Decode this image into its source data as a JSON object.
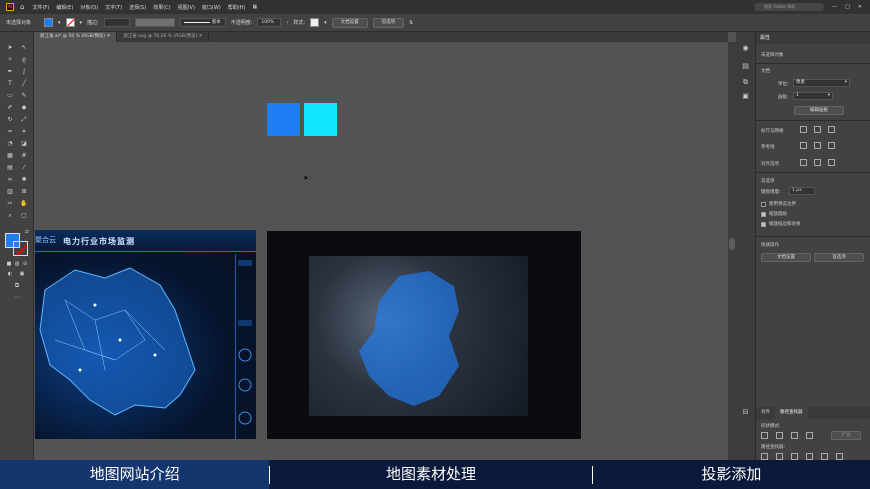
{
  "app": {
    "logo": "Ai",
    "menu": [
      "文件(F)",
      "编辑(E)",
      "对象(O)",
      "文字(T)",
      "选择(S)",
      "效果(C)",
      "视图(V)",
      "窗口(W)",
      "帮助(H)"
    ],
    "search_placeholder": "搜索 Adobe 帮助",
    "window_controls": [
      "—",
      "□",
      "✕"
    ]
  },
  "control_bar": {
    "selection_label": "未选择对象",
    "stroke_label": "描边:",
    "stroke_style": "基本",
    "opacity_label": "不透明度:",
    "opacity_value": "100%",
    "style_label": "样式:",
    "doc_setup_button": "文档设置",
    "prefs_button": "首选项"
  },
  "tabs": [
    {
      "label": "浙江省.ai* @ 50 % (RGB/预览)",
      "active": true
    },
    {
      "label": "浙江省.svg @ 76.26 % (RGB/预览)",
      "active": false
    }
  ],
  "canvas": {
    "square_colors": [
      "#1e7ef5",
      "#12e6ff"
    ],
    "image1": {
      "brand": "聚合云",
      "title": "电力行业市场监测"
    }
  },
  "properties_panel": {
    "title": "属性",
    "no_selection": "未选择对象",
    "document_section": "文档",
    "units_label": "单位:",
    "units_value": "像素",
    "artboard_label": "画板:",
    "artboard_value": "1",
    "edit_artboards_button": "编辑画板",
    "rulers_grids_label": "标尺与网格",
    "guides_label": "参考线",
    "snap_label": "对齐选项",
    "preferences_section": "首选项",
    "keyboard_increment_label": "键盘增量:",
    "keyboard_increment_value": "1 px",
    "checkbox_preview_bounds": "使用预览边界",
    "checkbox_scale_corners": "缩放圆角",
    "checkbox_scale_strokes": "缩放描边和效果",
    "quick_actions_section": "快速操作",
    "doc_setup_button": "文档设置",
    "prefs_button": "首选项",
    "bottom_tabs": [
      "对齐",
      "路径查找器"
    ],
    "shape_modes_label": "形状模式:",
    "expand_button": "扩展",
    "pathfinders_label": "路径查找器:"
  },
  "captions": [
    "地图网站介绍",
    "地图素材处理",
    "投影添加"
  ]
}
